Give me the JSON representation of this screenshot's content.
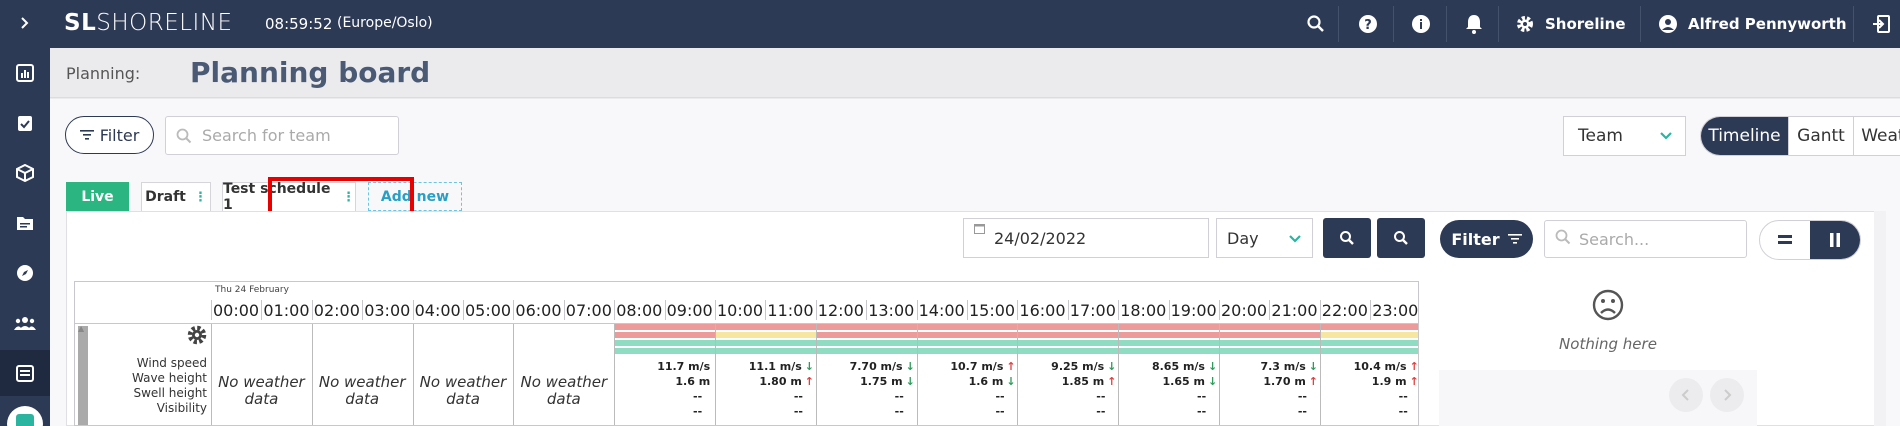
{
  "app": {
    "logo_prefix": "SL",
    "logo_text": "SHORELINE",
    "time": "08:59:52",
    "timezone": "(Europe/Oslo)",
    "org_name": "Shoreline",
    "user_name": "Alfred Pennyworth"
  },
  "header": {
    "breadcrumb": "Planning:",
    "title": "Planning board"
  },
  "toolbar": {
    "filter_label": "Filter",
    "search_placeholder": "Search for team",
    "team_select": "Team",
    "views": [
      "Timeline",
      "Gantt",
      "Weather"
    ],
    "active_view": "Timeline"
  },
  "tabs": [
    {
      "label": "Live"
    },
    {
      "label": "Draft"
    },
    {
      "label": "Test schedule 1"
    },
    {
      "label": "Add new"
    }
  ],
  "timeline": {
    "date_value": "24/02/2022",
    "range": "Day",
    "day_label": "Thu 24 February",
    "hours": [
      "00:00",
      "01:00",
      "02:00",
      "03:00",
      "04:00",
      "05:00",
      "06:00",
      "07:00",
      "08:00",
      "09:00",
      "10:00",
      "11:00",
      "12:00",
      "13:00",
      "14:00",
      "15:00",
      "16:00",
      "17:00",
      "18:00",
      "19:00",
      "20:00",
      "21:00",
      "22:00",
      "23:00"
    ],
    "row_labels": [
      "Wind speed",
      "Wave height",
      "Swell height",
      "Visibility"
    ],
    "no_data_text": "No weather data",
    "weather": [
      {
        "wind": "11.7 m/s",
        "wind_dir": "",
        "wave": "1.6 m",
        "wave_dir": "",
        "swell": "--",
        "vis": "--"
      },
      {
        "wind": "11.1 m/s",
        "wind_dir": "↓",
        "wave": "1.80 m",
        "wave_dir": "↑",
        "swell": "--",
        "vis": "--"
      },
      {
        "wind": "7.70 m/s",
        "wind_dir": "↓",
        "wave": "1.75 m",
        "wave_dir": "↓",
        "swell": "--",
        "vis": "--"
      },
      {
        "wind": "10.7 m/s",
        "wind_dir": "↑",
        "wave": "1.6 m",
        "wave_dir": "↓",
        "swell": "--",
        "vis": "--"
      },
      {
        "wind": "9.25 m/s",
        "wind_dir": "↓",
        "wave": "1.85 m",
        "wave_dir": "↑",
        "swell": "--",
        "vis": "--"
      },
      {
        "wind": "8.65 m/s",
        "wind_dir": "↓",
        "wave": "1.65 m",
        "wave_dir": "↓",
        "swell": "--",
        "vis": "--"
      },
      {
        "wind": "7.3 m/s",
        "wind_dir": "↓",
        "wave": "1.70 m",
        "wave_dir": "↑",
        "swell": "--",
        "vis": "--"
      },
      {
        "wind": "10.4 m/s",
        "wind_dir": "↑",
        "wave": "1.9 m",
        "wave_dir": "↑",
        "swell": "--",
        "vis": "--"
      }
    ]
  },
  "right_panel": {
    "filter_label": "Filter",
    "search_placeholder": "Search...",
    "empty_text": "Nothing here"
  },
  "colors": {
    "navy": "#2d3a55",
    "teal": "#2bb5a0",
    "live_green": "#2bb580",
    "bar_red": "#ec9a9a",
    "bar_yellow": "#f7e6a0",
    "bar_green": "#8fdcc3"
  }
}
